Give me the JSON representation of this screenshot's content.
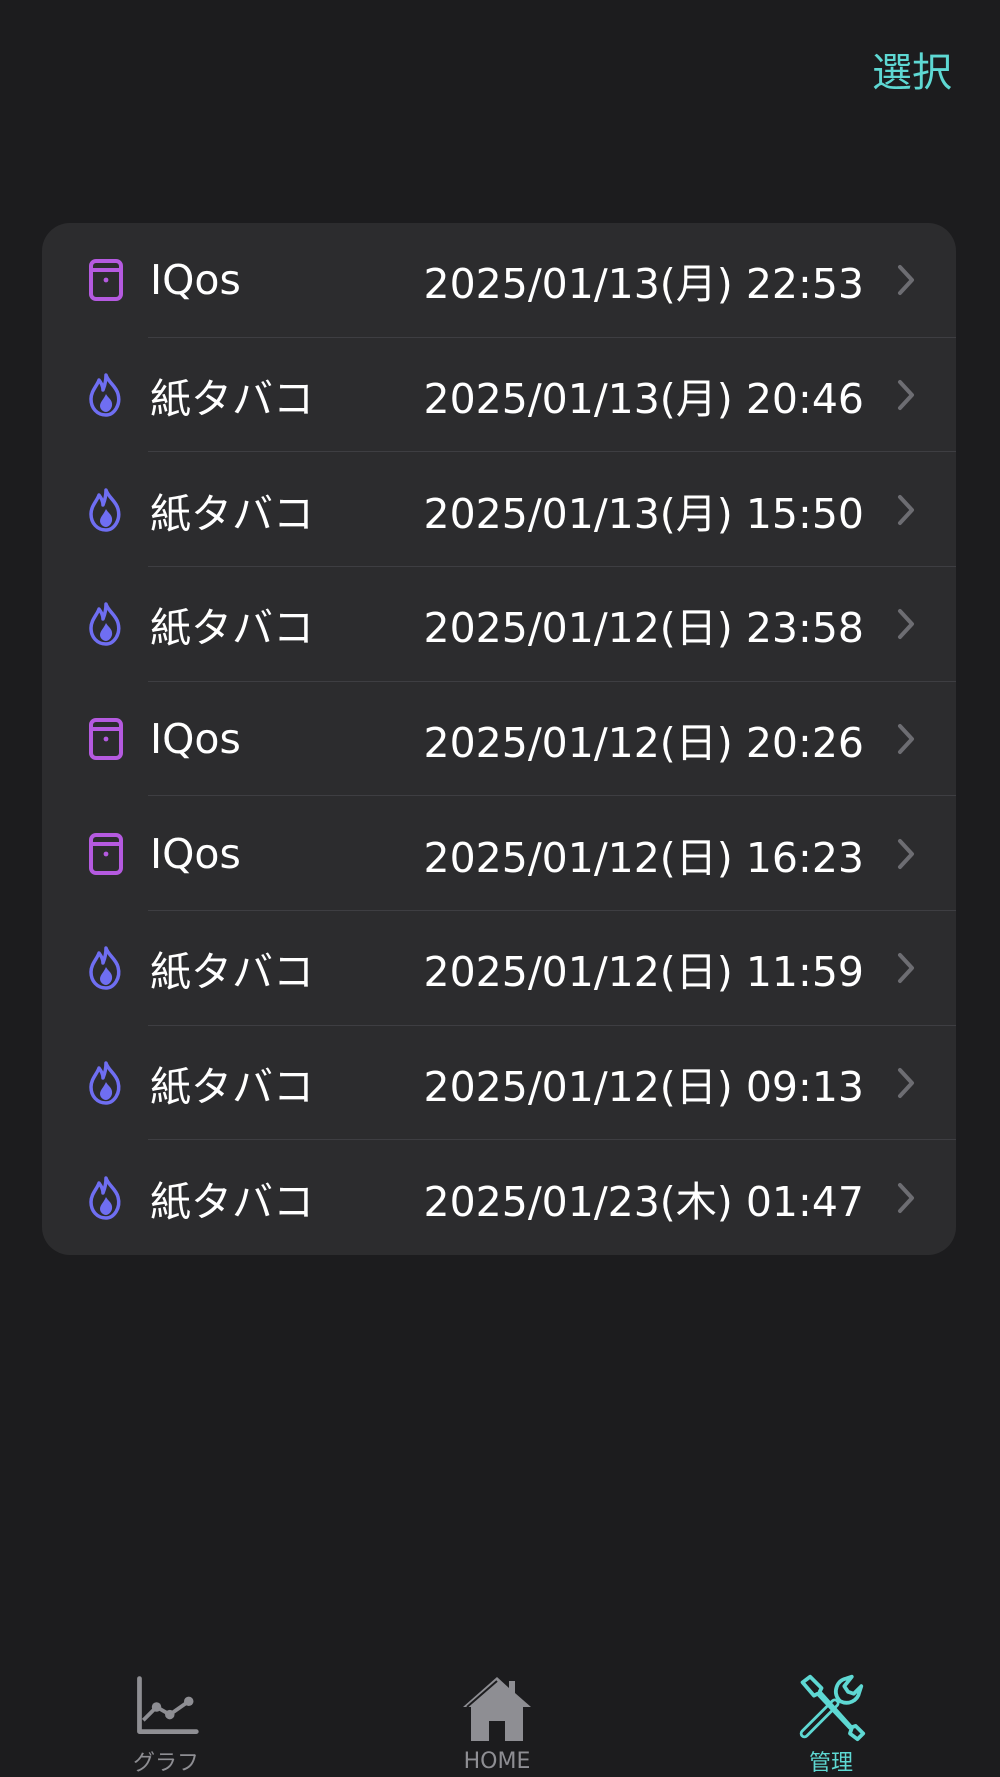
{
  "header": {
    "select_label": "選択"
  },
  "records": [
    {
      "type": "iqos",
      "icon": "device-icon",
      "label": "IQos",
      "datetime": "2025/01/13(月) 22:53"
    },
    {
      "type": "paper",
      "icon": "flame-icon",
      "label": "紙タバコ",
      "datetime": "2025/01/13(月) 20:46"
    },
    {
      "type": "paper",
      "icon": "flame-icon",
      "label": "紙タバコ",
      "datetime": "2025/01/13(月) 15:50"
    },
    {
      "type": "paper",
      "icon": "flame-icon",
      "label": "紙タバコ",
      "datetime": "2025/01/12(日) 23:58"
    },
    {
      "type": "iqos",
      "icon": "device-icon",
      "label": "IQos",
      "datetime": "2025/01/12(日) 20:26"
    },
    {
      "type": "iqos",
      "icon": "device-icon",
      "label": "IQos",
      "datetime": "2025/01/12(日) 16:23"
    },
    {
      "type": "paper",
      "icon": "flame-icon",
      "label": "紙タバコ",
      "datetime": "2025/01/12(日) 11:59"
    },
    {
      "type": "paper",
      "icon": "flame-icon",
      "label": "紙タバコ",
      "datetime": "2025/01/12(日) 09:13"
    },
    {
      "type": "paper",
      "icon": "flame-icon",
      "label": "紙タバコ",
      "datetime": "2025/01/23(木) 01:47"
    }
  ],
  "tabbar": {
    "graph_label": "グラフ",
    "home_label": "HOME",
    "manage_label": "管理",
    "active_tab": "manage"
  },
  "colors": {
    "background": "#1c1c1e",
    "card": "#2c2c2e",
    "accent": "#5ed8d3",
    "iqos_icon": "#b55ae0",
    "paper_icon": "#6f6ef2",
    "inactive_tab": "#8e8e93"
  }
}
